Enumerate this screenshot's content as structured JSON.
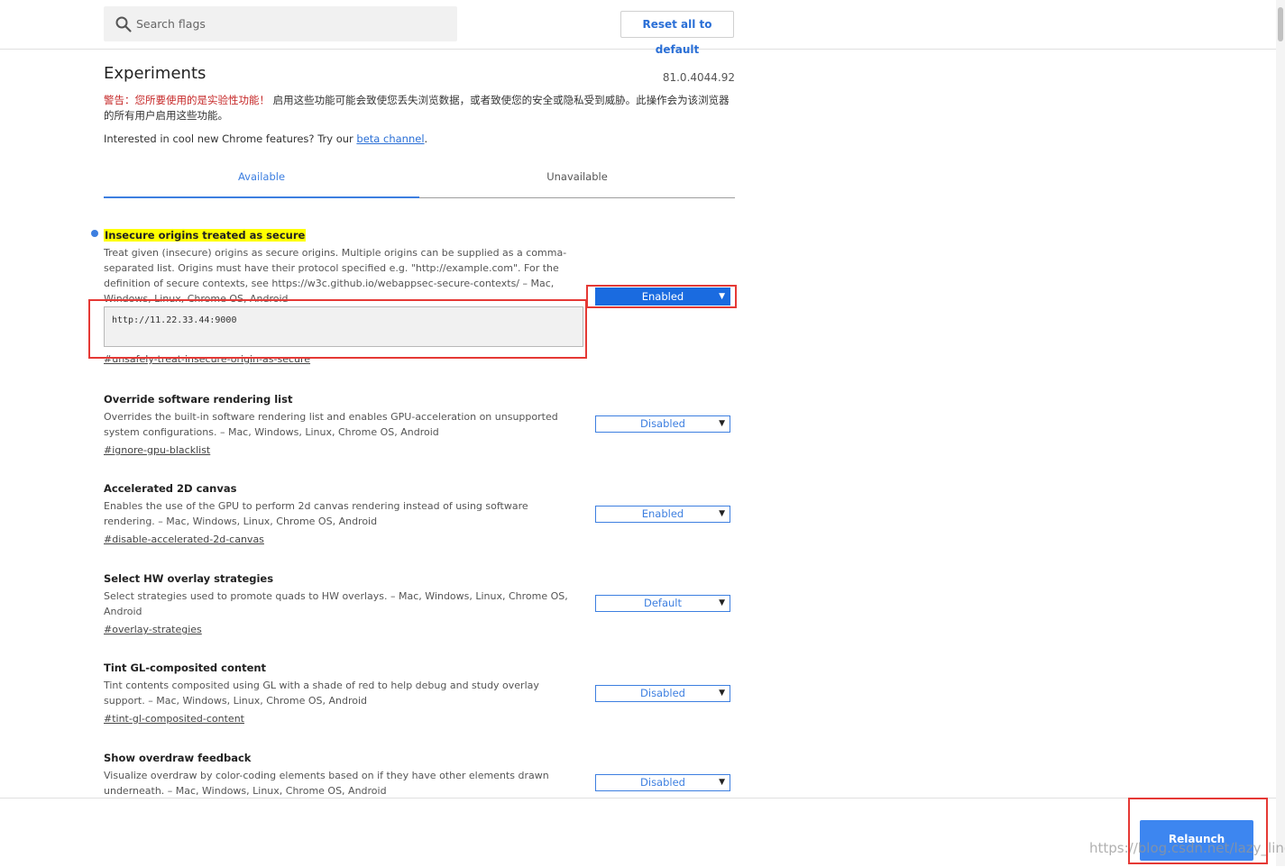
{
  "header": {
    "search_placeholder": "Search flags",
    "search_icon": "search-icon",
    "reset_label": "Reset all to default"
  },
  "main": {
    "title": "Experiments",
    "version": "81.0.4044.92",
    "warning_prefix": "警告：您所要使用的是实验性功能！",
    "warning_body": " 启用这些功能可能会致使您丢失浏览数据，或者致使您的安全或隐私受到威胁。此操作会为该浏览器的所有用户启用这些功能。",
    "intro_text": "Interested in cool new Chrome features? Try our ",
    "intro_link": "beta channel",
    "intro_end": ".",
    "tabs": [
      {
        "label": "Available",
        "active": true
      },
      {
        "label": "Unavailable",
        "active": false
      }
    ]
  },
  "flags": [
    {
      "title": "Insecure origins treated as secure",
      "description": "Treat given (insecure) origins as secure origins. Multiple origins can be supplied as a comma-separated list. Origins must have their protocol specified e.g. \"http://example.com\". For the definition of secure contexts, see https://w3c.github.io/webappsec-secure-contexts/ – Mac, Windows, Linux, Chrome OS, Android",
      "input_value": "http://11.22.33.44:9000",
      "link": "#unsafely-treat-insecure-origin-as-secure",
      "value": "Enabled"
    },
    {
      "title": "Override software rendering list",
      "description": "Overrides the built-in software rendering list and enables GPU-acceleration on unsupported system configurations. – Mac, Windows, Linux, Chrome OS, Android",
      "link": "#ignore-gpu-blacklist",
      "value": "Disabled"
    },
    {
      "title": "Accelerated 2D canvas",
      "description": "Enables the use of the GPU to perform 2d canvas rendering instead of using software rendering. – Mac, Windows, Linux, Chrome OS, Android",
      "link": "#disable-accelerated-2d-canvas",
      "value": "Enabled"
    },
    {
      "title": "Select HW overlay strategies",
      "description": "Select strategies used to promote quads to HW overlays. – Mac, Windows, Linux, Chrome OS, Android",
      "link": "#overlay-strategies",
      "value": "Default"
    },
    {
      "title": "Tint GL-composited content",
      "description": "Tint contents composited using GL with a shade of red to help debug and study overlay support. – Mac, Windows, Linux, Chrome OS, Android",
      "link": "#tint-gl-composited-content",
      "value": "Disabled"
    },
    {
      "title": "Show overdraw feedback",
      "description": "Visualize overdraw by color-coding elements based on if they have other elements drawn underneath. – Mac, Windows, Linux, Chrome OS, Android",
      "value": "Disabled"
    }
  ],
  "select_arrow": "▼",
  "footer": {
    "relaunch_label": "Relaunch",
    "watermark": "https://blog.csdn.net/lazy_ling"
  },
  "colors": {
    "accent": "#3d7fe0",
    "highlight": "#ffff00",
    "annotation": "#e53935",
    "warning": "#c62828"
  }
}
